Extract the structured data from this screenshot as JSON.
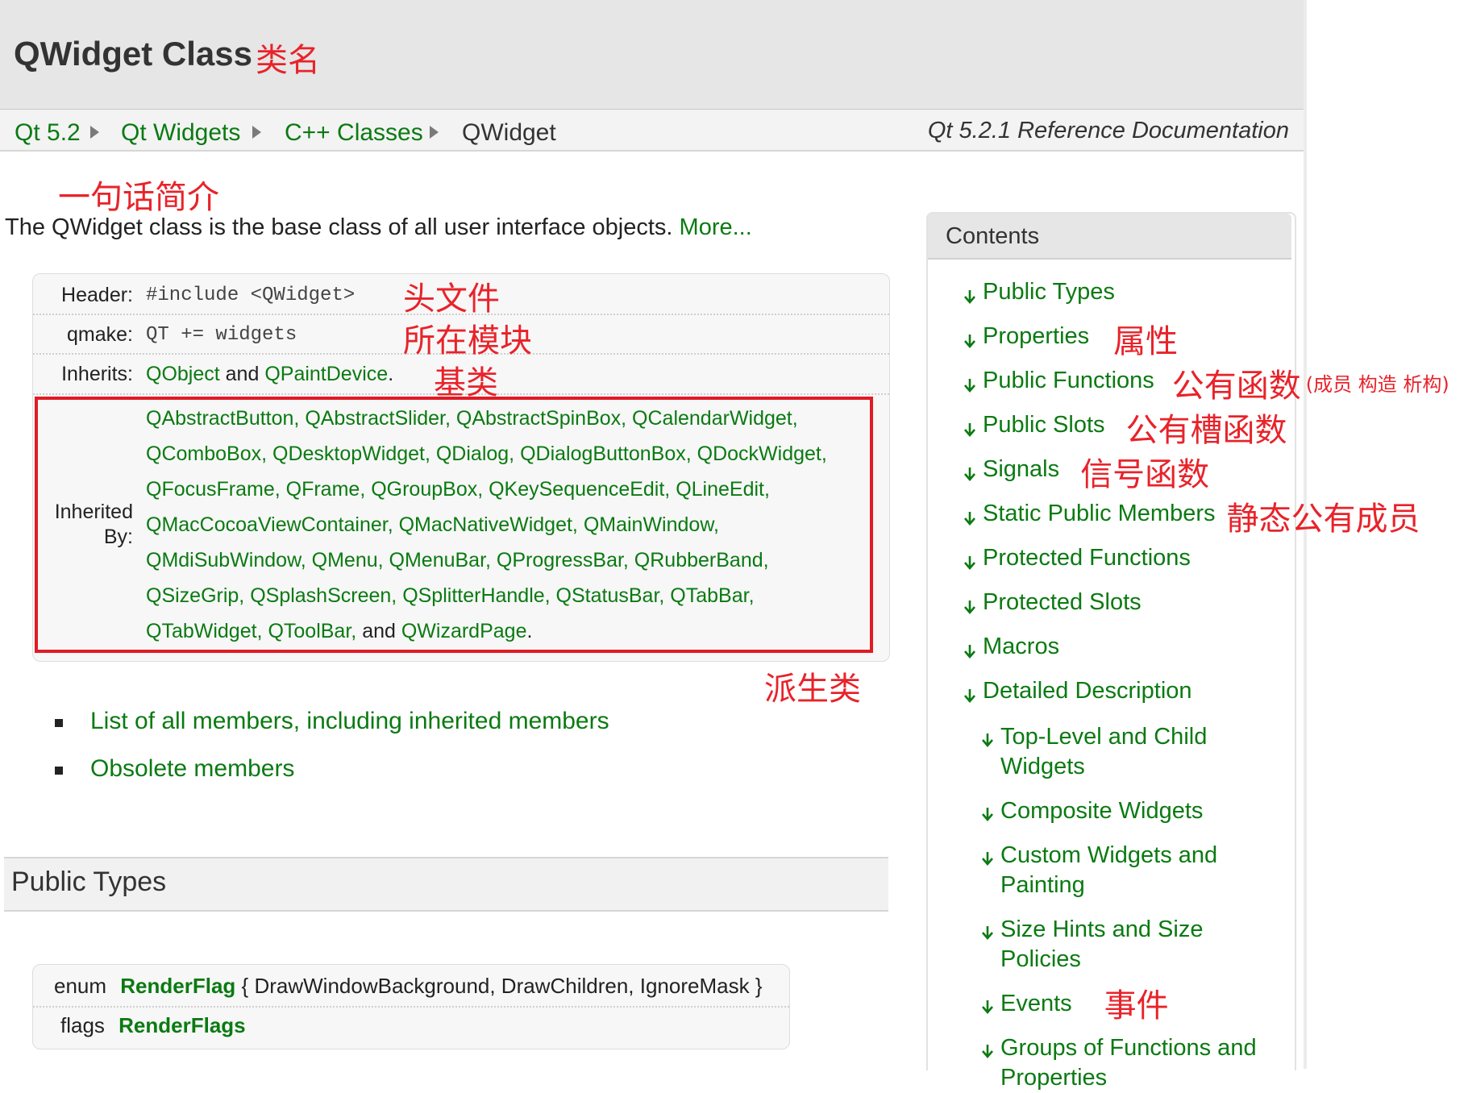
{
  "header": {
    "class_title": "QWidget Class",
    "title_annotation": "类名"
  },
  "breadcrumb": {
    "items": [
      "Qt 5.2",
      "Qt Widgets",
      "C++ Classes"
    ],
    "current": "QWidget",
    "ref_doc": "Qt 5.2.1 Reference Documentation"
  },
  "summary": {
    "annotation": "一句话简介",
    "text": "The QWidget class is the base class of all user interface objects.",
    "more_link": "More..."
  },
  "info": {
    "header_label": "Header:",
    "header_value": "#include <QWidget>",
    "header_annotation": "头文件",
    "qmake_label": "qmake:",
    "qmake_value": "QT += widgets",
    "qmake_annotation": "所在模块",
    "inherits_label": "Inherits:",
    "inherits_link1": "QObject",
    "inherits_and": "and",
    "inherits_link2": "QPaintDevice",
    "inherits_period": ".",
    "inherits_annotation": "基类",
    "inherited_by_label_1": "Inherited",
    "inherited_by_label_2": "By:",
    "inherited_by_lines": [
      "QAbstractButton, QAbstractSlider, QAbstractSpinBox, QCalendarWidget,",
      "QComboBox, QDesktopWidget, QDialog, QDialogButtonBox, QDockWidget,",
      "QFocusFrame, QFrame, QGroupBox, QKeySequenceEdit, QLineEdit,",
      "QMacCocoaViewContainer, QMacNativeWidget, QMainWindow,",
      "QMdiSubWindow, QMenu, QMenuBar, QProgressBar, QRubberBand,",
      "QSizeGrip, QSplashScreen, QSplitterHandle, QStatusBar, QTabBar,"
    ],
    "inherited_by_last_links": "QTabWidget, QToolBar,",
    "inherited_by_last_and": "and",
    "inherited_by_last_link": "QWizardPage",
    "inherited_by_last_period": ".",
    "inherited_by_annotation": "派生类"
  },
  "member_links": [
    "List of all members, including inherited members",
    "Obsolete members"
  ],
  "public_types": {
    "title": "Public Types",
    "rows": [
      {
        "kw": "enum",
        "name": "RenderFlag",
        "rest": "{ DrawWindowBackground, DrawChildren, IgnoreMask }"
      },
      {
        "kw": "flags",
        "name": "RenderFlags",
        "rest": ""
      }
    ]
  },
  "contents": {
    "title": "Contents",
    "items": [
      {
        "label": "Public Types",
        "annotation": ""
      },
      {
        "label": "Properties",
        "annotation": "属性"
      },
      {
        "label": "Public Functions",
        "annotation": "公有函数",
        "note": "(成员 构造 析构)"
      },
      {
        "label": "Public Slots",
        "annotation": "公有槽函数"
      },
      {
        "label": "Signals",
        "annotation": "信号函数"
      },
      {
        "label": "Static Public Members",
        "annotation": "静态公有成员"
      },
      {
        "label": "Protected Functions",
        "annotation": ""
      },
      {
        "label": "Protected Slots",
        "annotation": ""
      },
      {
        "label": "Macros",
        "annotation": ""
      },
      {
        "label": "Detailed Description",
        "annotation": ""
      }
    ],
    "sub_items": [
      {
        "lines": [
          "Top-Level and Child",
          "Widgets"
        ],
        "annotation": ""
      },
      {
        "lines": [
          "Composite Widgets"
        ],
        "annotation": ""
      },
      {
        "lines": [
          "Custom Widgets and",
          "Painting"
        ],
        "annotation": ""
      },
      {
        "lines": [
          "Size Hints and Size",
          "Policies"
        ],
        "annotation": ""
      },
      {
        "lines": [
          "Events"
        ],
        "annotation": "事件"
      },
      {
        "lines": [
          "Groups of Functions and",
          "Properties"
        ],
        "annotation": ""
      }
    ]
  },
  "colors": {
    "link_green": "#0b7a12",
    "annotation_red": "#e8232a",
    "frame_red": "#e11b25"
  }
}
